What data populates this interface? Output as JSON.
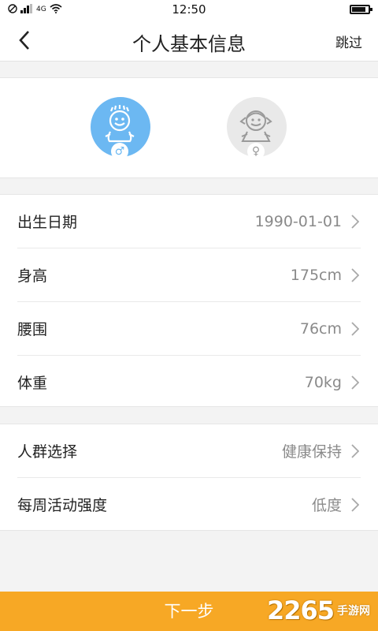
{
  "status_bar": {
    "time": "12:50",
    "signal_text": "4G",
    "battery_level": 0.85
  },
  "nav": {
    "title": "个人基本信息",
    "skip_label": "跳过"
  },
  "gender": {
    "options": [
      {
        "id": "male",
        "symbol": "♂",
        "selected": true,
        "color": "#6cb8f2"
      },
      {
        "id": "female",
        "symbol": "♀",
        "selected": false,
        "color": "#e9e9e9"
      }
    ]
  },
  "body_info": [
    {
      "label": "出生日期",
      "value": "1990-01-01"
    },
    {
      "label": "身高",
      "value": "175cm"
    },
    {
      "label": "腰围",
      "value": "76cm"
    },
    {
      "label": "体重",
      "value": "70kg"
    }
  ],
  "lifestyle": [
    {
      "label": "人群选择",
      "value": "健康保持"
    },
    {
      "label": "每周活动强度",
      "value": "低度"
    }
  ],
  "next_label": "下一步",
  "watermark": {
    "number": "2265",
    "site_text": "手游网"
  },
  "colors": {
    "accent": "#f7a825",
    "male": "#6cb8f2"
  }
}
